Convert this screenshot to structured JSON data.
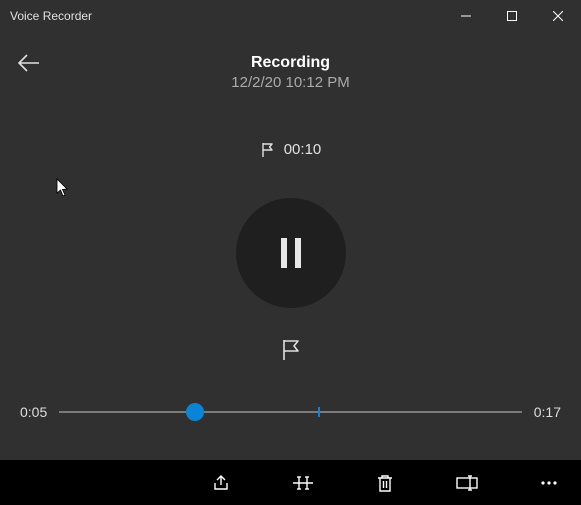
{
  "titlebar": {
    "app_name": "Voice Recorder"
  },
  "header": {
    "status": "Recording",
    "timestamp": "12/2/20 10:12 PM"
  },
  "marker": {
    "time": "00:10"
  },
  "playback": {
    "current": "0:05",
    "total": "0:17",
    "playhead_percent": 29.4,
    "marker_percent": 56
  },
  "icons": {
    "back": "back-arrow-icon",
    "flag_small": "flag-icon",
    "pause": "pause-icon",
    "flag": "flag-icon",
    "share": "share-icon",
    "trim": "trim-icon",
    "delete": "trash-icon",
    "rename": "rename-icon",
    "more": "more-icon",
    "minimize": "minimize-icon",
    "maximize": "maximize-icon",
    "close": "close-icon"
  }
}
